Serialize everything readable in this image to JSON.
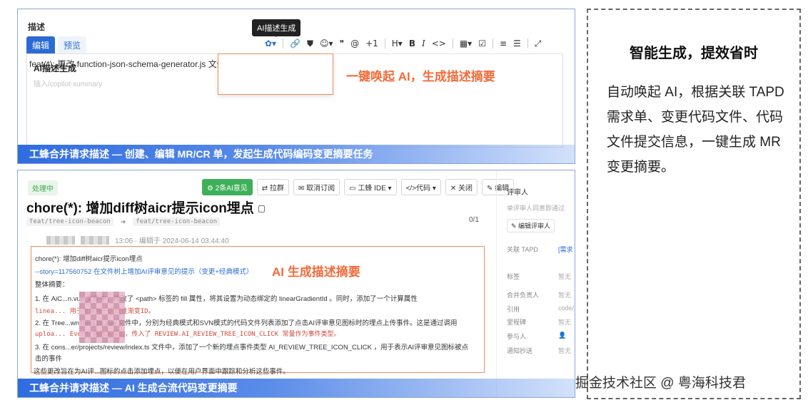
{
  "top_panel": {
    "description_label": "描述",
    "tabs": [
      {
        "label": "编辑"
      },
      {
        "label": "预览"
      }
    ],
    "toolbar": [
      "✿▾",
      "🔗",
      "⛊",
      "☺▾",
      "❞",
      "@",
      "+1",
      "H▾",
      "B",
      "I",
      "<>",
      "▦▾",
      "☑",
      "≡",
      "☰",
      "⤢"
    ],
    "tooltip": "AI描述生成",
    "editor_text": "feat(*): 更改 function-json-schema-generator.js 文件",
    "dropdown": {
      "title": "AI描述生成",
      "subtitle": "插入/copilot-summary"
    },
    "callout": "一键唤起 AI，生成描述摘要",
    "banner": "工蜂合并请求描述 — 创建、编辑 MR/CR 单，发起生成代码编码变更摘要任务"
  },
  "bottom_panel": {
    "status": "处理中",
    "title": "chore(*): 增加diff树aicr提示icon埋点",
    "actions": [
      "⚙ 2条AI意见",
      "⇄ 拉群",
      "✉ 取消订阅",
      "▭ 工蜂 IDE ▾",
      "</>代码 ▾",
      "✕ 关闭",
      "✎ 编辑"
    ],
    "branch_from": "feat/tree-icon-beacon",
    "branch_to": "feat/tree-icon-beacon",
    "count": "0/1",
    "meta_time": "13:06 · 编辑于 2024-06-14 03:44:40",
    "summary_lines": [
      "chore(*): 增加diff树aicr提示icon埋点",
      "--story=117560752 在文件树上增加AI评审意见的提示（变更+经典模式）",
      "整体摘要：",
      "1. 在 AiC...n.vue 文件中，修改了 <path> 标签的 fill 属性，将其设置为动态绑定的 linearGradientId 。同时，添加了一个计算属性",
      "   linea...   用于生成唯一的线性渐变ID。",
      "2. 在 Tree...wnTreeList.vue 文件中，分别为经典模式和SVN模式的代码文件列表添加了点击AI评审意见图标时的埋点上传事件。这是通过调用",
      "   uploa...   Event 函数实现的，传入了 REVIEW.AI_REVIEW_TREE_ICON_CLICK 常量作为事件类型。",
      "3. 在 cons...er/projects/review/index.ts 文件中，添加了一个新的埋点事件类型 AI_REVIEW_TREE_ICON_CLICK ，用于表示AI评审意见图标被点",
      "   击的事件",
      "这些更改旨在为AI评...图标的点击添加埋点，以便在用户界面中跟踪和分析这些事件。"
    ],
    "callout": "AI 生成描述摘要",
    "banner": "工蜂合并请求描述 — AI 生成合流代码变更摘要",
    "sidebar": {
      "reviewer_label": "评审人",
      "check_label": "单评审人同意即通过",
      "edit_reviewer": "✎ 编辑评审人",
      "rows": [
        {
          "label": "关联 TAPD",
          "value": "[需求"
        },
        {
          "label": "标签",
          "value": "暂无"
        },
        {
          "label": "合并负责人",
          "value": "暂无"
        },
        {
          "label": "引用",
          "value": "code/"
        },
        {
          "label": "里程碑",
          "value": "暂无"
        },
        {
          "label": "参与人",
          "value": "👤"
        },
        {
          "label": "通知抄送",
          "value": "暂无"
        }
      ]
    }
  },
  "right_panel": {
    "title": "智能生成，提效省时",
    "body": "自动唤起 AI，根据关联 TAPD需求单、变更代码文件、代码文件提交信息，一键生成 MR 变更摘要。"
  },
  "watermark": "掘金技术社区 @ 粤海科技君"
}
